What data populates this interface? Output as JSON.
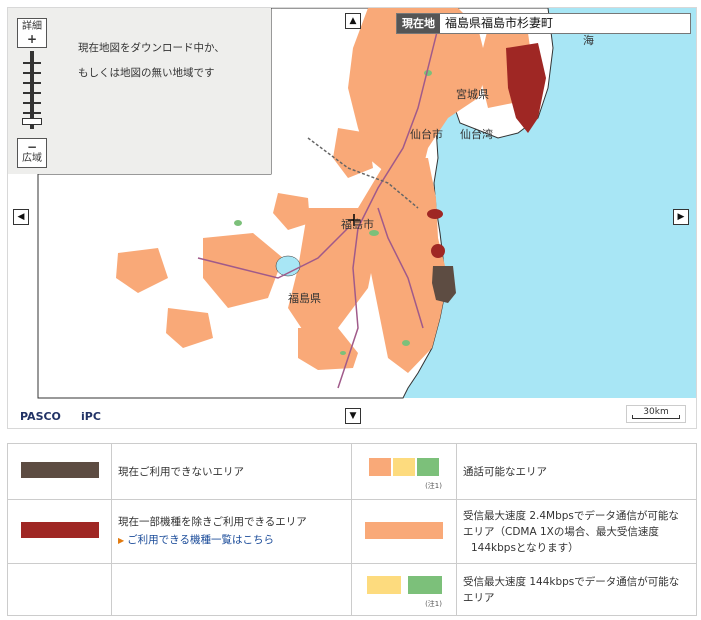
{
  "map": {
    "notice_line1": "現在地図をダウンロード中か、",
    "notice_line2": "もしくは地図の無い地域です",
    "zoom_in_label": "詳細",
    "zoom_in_symbol": "+",
    "zoom_out_symbol": "−",
    "zoom_out_label": "広域",
    "arrow_up": "▲",
    "arrow_down": "▼",
    "arrow_left": "◀",
    "arrow_right": "▶",
    "location_label": "現在地",
    "location_value": "福島県福島市杉妻町",
    "labels": {
      "miyagi": "宮城県",
      "sendai_city": "仙台市",
      "sendai_bay": "仙台湾",
      "fukushima_city": "福島市",
      "fukushima_pref": "福島県",
      "sea_partial": "海"
    },
    "logo_pasco": "PASCO",
    "logo_ipc": "iPC",
    "scale": "30km",
    "colors": {
      "sea": "#a8e6f5",
      "land": "#ffffff",
      "coverage": "#f9a978",
      "unavailable": "#5d4c42",
      "partial": "#9f2724"
    }
  },
  "legend": {
    "row1": {
      "text": "現在ご利用できないエリア",
      "right_text": "通話可能なエリア",
      "note": "(注1)"
    },
    "row2": {
      "text": "現在一部機種を除きご利用できるエリア",
      "link": "ご利用できる機種一覧はこちら",
      "right_line1": "受信最大速度 2.4Mbpsでデータ通信が可能な",
      "right_line2": "エリア（CDMA 1Xの場合、最大受信速度",
      "right_line3": "144kbpsとなります）"
    },
    "row3": {
      "right_line1": "受信最大速度 144kbpsでデータ通信が可能な",
      "right_line2": "エリア",
      "note": "(注1)"
    },
    "colors": {
      "orange": "#f9a978",
      "yellow": "#fddb7e",
      "green": "#7cc07a"
    }
  }
}
